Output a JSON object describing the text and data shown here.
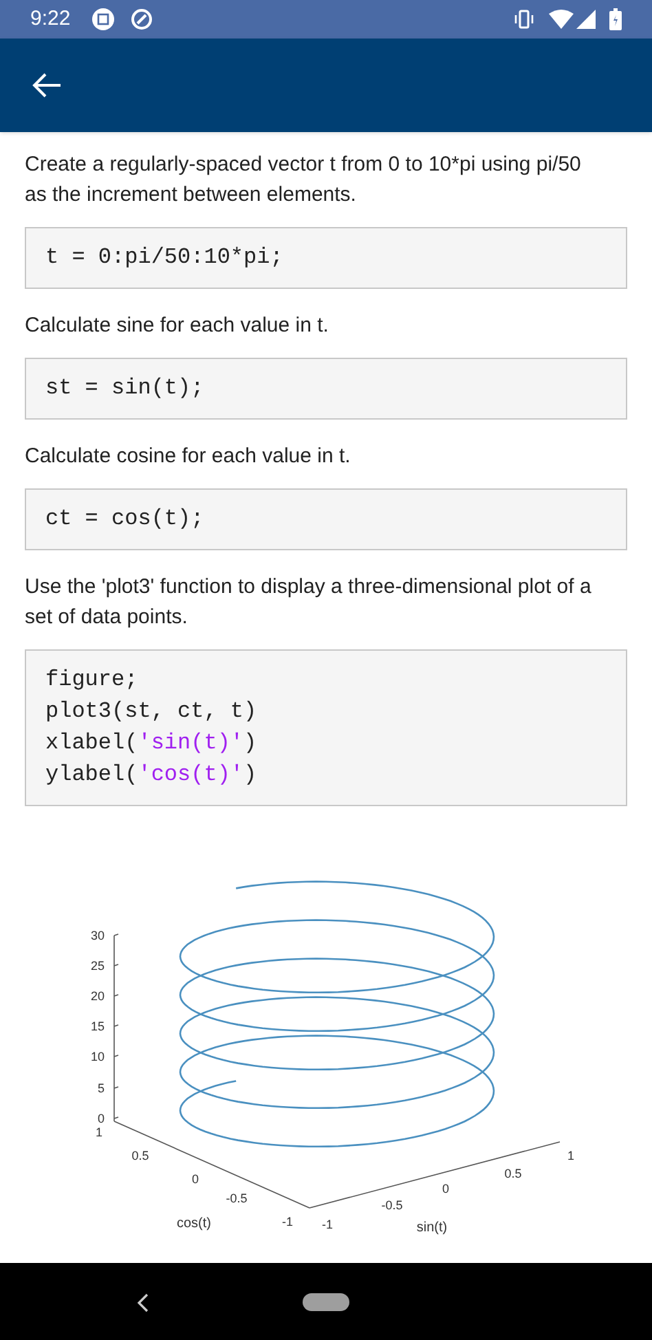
{
  "status_bar": {
    "time": "9:22"
  },
  "sections": [
    {
      "text": "Create a regularly-spaced vector t from 0 to 10*pi using pi/50 as the increment between elements.",
      "code": [
        [
          {
            "kind": "plain",
            "text": "t = 0:pi/50:10*pi;"
          }
        ]
      ]
    },
    {
      "text": "Calculate sine for each value in t.",
      "code": [
        [
          {
            "kind": "plain",
            "text": "st = sin(t);"
          }
        ]
      ]
    },
    {
      "text": "Calculate cosine for each value in t.",
      "code": [
        [
          {
            "kind": "plain",
            "text": "ct = cos(t);"
          }
        ]
      ]
    },
    {
      "text": "Use the 'plot3' function to display a three-dimensional plot of a set of data points.",
      "code": [
        [
          {
            "kind": "plain",
            "text": "figure;"
          }
        ],
        [
          {
            "kind": "plain",
            "text": "plot3(st, ct, t)"
          }
        ],
        [
          {
            "kind": "plain",
            "text": "xlabel("
          },
          {
            "kind": "string",
            "text": "'sin(t)'"
          },
          {
            "kind": "plain",
            "text": ")"
          }
        ],
        [
          {
            "kind": "plain",
            "text": "ylabel("
          },
          {
            "kind": "string",
            "text": "'cos(t)'"
          },
          {
            "kind": "plain",
            "text": ")"
          }
        ]
      ]
    }
  ],
  "plot": {
    "z_ticks": [
      "30",
      "25",
      "20",
      "15",
      "10",
      "5",
      "0"
    ],
    "cos_ticks": [
      "1",
      "0.5",
      "0",
      "-0.5",
      "-1"
    ],
    "sin_ticks": [
      "-1",
      "-0.5",
      "0",
      "0.5",
      "1"
    ],
    "cos_label": "cos(t)",
    "sin_label": "sin(t)"
  }
}
